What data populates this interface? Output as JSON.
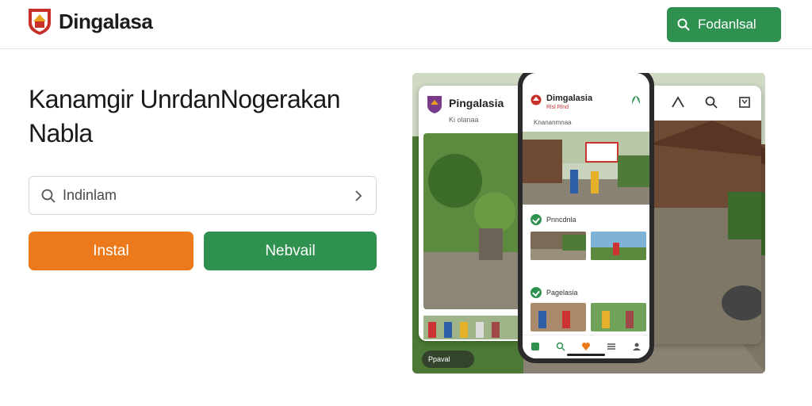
{
  "header": {
    "brand": "Dingalasa",
    "cta_label": "Fodanlsal"
  },
  "hero": {
    "title_line1": "Kanamgir UnrdanNogerakan",
    "title_line2": "Nabla",
    "search_value": "Indinlam",
    "install_label": "Instal",
    "next_label": "Nebvail"
  },
  "preview": {
    "left_card_brand": "Pingalasia",
    "left_card_sub": "Ki olanaa",
    "phone_app_title": "Dimgalasia",
    "phone_app_sub": "Rlsl Rlnd",
    "phone_nav": "Knananmnaa",
    "phone_section1": "Pnncdnla",
    "phone_section2": "Pagelasia",
    "badge_text": "Ppaval"
  },
  "colors": {
    "primary_green": "#2e9150",
    "accent_orange": "#ec7a1c",
    "logo_red": "#c8302a"
  }
}
